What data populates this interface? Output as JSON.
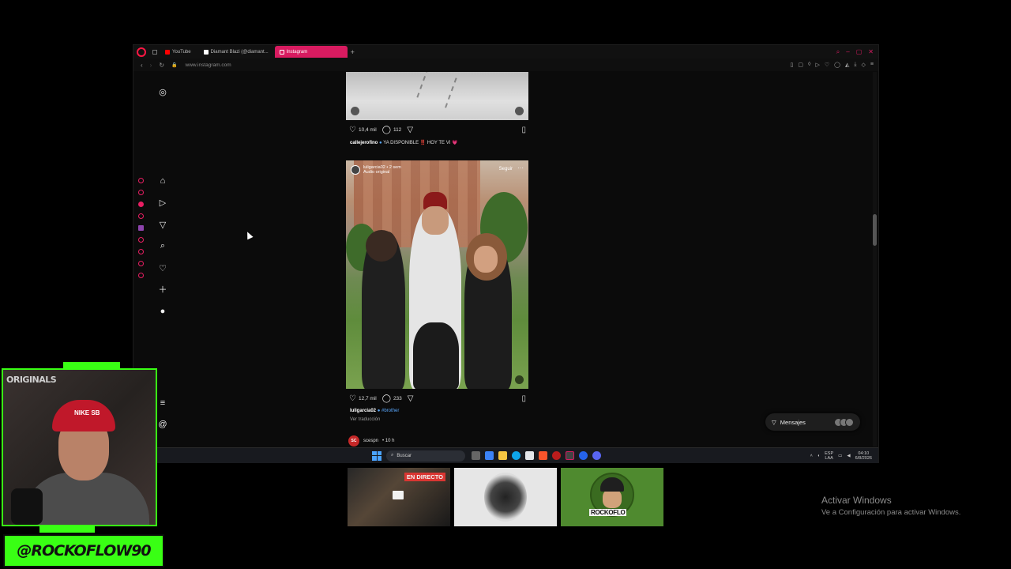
{
  "browser": {
    "tabs": [
      {
        "label": "YouTube",
        "icon": "youtube-icon",
        "color": "#ff0000"
      },
      {
        "label": "Diamant Blazi (@diamant...",
        "icon": "tiktok-icon",
        "color": "#ffffff"
      },
      {
        "label": "Instagram",
        "icon": "instagram-icon",
        "color": "#ffffff",
        "active": true
      }
    ],
    "new_tab": "+",
    "url": "www.instagram.com",
    "accent": "#d81b60"
  },
  "instagram": {
    "nav": [
      "instagram-logo-icon",
      "home-icon",
      "reels-icon",
      "direct-icon",
      "search-icon",
      "heart-icon",
      "create-icon",
      "profile-icon",
      "menu-icon",
      "threads-icon"
    ],
    "post1": {
      "likes": "10,4 mil",
      "comments": "112",
      "user": "callejerofino",
      "caption": "YA DISPONIBLE ‼️ HOY TE VI 💗"
    },
    "post2": {
      "user": "luligarcia02",
      "time": "• 2 sem",
      "audio": "Audio original",
      "follow": "Seguir",
      "likes": "12,7 mil",
      "comments": "233",
      "hashtag": "#brother",
      "translate": "Ver traducción"
    },
    "post3": {
      "user": "scespn",
      "time": "• 10 h",
      "avatar_text": "SC"
    },
    "messages": "Mensajes"
  },
  "taskbar": {
    "search_placeholder": "Buscar",
    "lang1": "ESP",
    "lang2": "LAA",
    "time": "04:10",
    "date": "6/8/2026"
  },
  "stream": {
    "originals": "ORIGINALS",
    "cap_logo": "NIKE SB",
    "handle": "@ROCKOFLOW90",
    "live_badge": "EN DIRECTO",
    "card3_brand": "ROCKOFLO",
    "neon": "#39ff14"
  },
  "windows": {
    "activate_title": "Activar Windows",
    "activate_sub": "Ve a Configuración para activar Windows."
  }
}
